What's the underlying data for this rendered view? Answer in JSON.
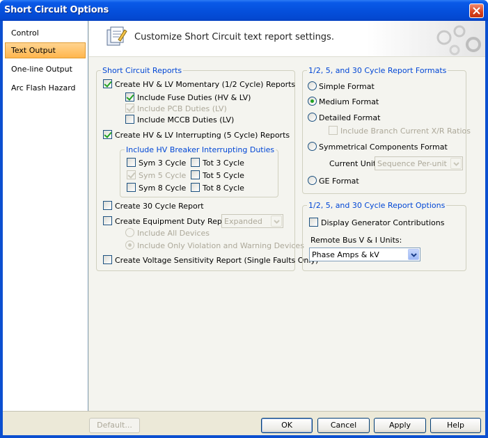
{
  "window": {
    "title": "Short Circuit Options"
  },
  "sidebar": {
    "items": [
      {
        "label": "Control"
      },
      {
        "label": "Text Output"
      },
      {
        "label": "One-line Output"
      },
      {
        "label": "Arc Flash Hazard"
      }
    ]
  },
  "header": {
    "text": "Customize Short Circuit text report settings."
  },
  "reports": {
    "title": "Short Circuit Reports",
    "momentary": "Create HV & LV Momentary (1/2 Cycle) Reports",
    "fuse": "Include Fuse Duties (HV & LV)",
    "pcb": "Include PCB Duties (LV)",
    "mccb": "Include MCCB Duties (LV)",
    "interrupting": "Create HV & LV Interrupting (5 Cycle) Reports",
    "hv_group_title": "Include HV Breaker Interrupting Duties",
    "sym3": "Sym 3 Cycle",
    "tot3": "Tot 3 Cycle",
    "sym5": "Sym 5 Cycle",
    "tot5": "Tot 5 Cycle",
    "sym8": "Sym 8 Cycle",
    "tot8": "Tot 8 Cycle",
    "cycle30": "Create 30 Cycle Report",
    "equipment_duty": "Create Equipment Duty Report:",
    "equipment_duty_value": "Expanded",
    "include_all": "Include All Devices",
    "include_violation": "Include Only Violation and Warning Devices",
    "voltage_sensitivity": "Create Voltage Sensitivity Report (Single Faults Only)"
  },
  "formats": {
    "title": "1/2, 5, and 30 Cycle Report Formats",
    "simple": "Simple Format",
    "medium": "Medium Format",
    "detailed": "Detailed Format",
    "branch_xr": "Include Branch Current X/R Ratios",
    "symmetrical": "Symmetrical Components Format",
    "current_unit_label": "Current Unit:",
    "current_unit_value": "Sequence Per-unit",
    "ge": "GE Format"
  },
  "options": {
    "title": "1/2, 5, and 30 Cycle Report Options",
    "display_gen": "Display Generator Contributions",
    "remote_bus_label": "Remote Bus V & I Units:",
    "remote_bus_value": "Phase Amps & kV"
  },
  "footer": {
    "default": "Default...",
    "ok": "OK",
    "cancel": "Cancel",
    "apply": "Apply",
    "help": "Help"
  },
  "colors": {
    "accent": "#0046d5",
    "selected_tab": "#ffc66b",
    "check": "#21a121",
    "titlebar": "#0550dd"
  },
  "icons": {
    "header": "report-settings-icon",
    "decor": "gears-icon"
  }
}
